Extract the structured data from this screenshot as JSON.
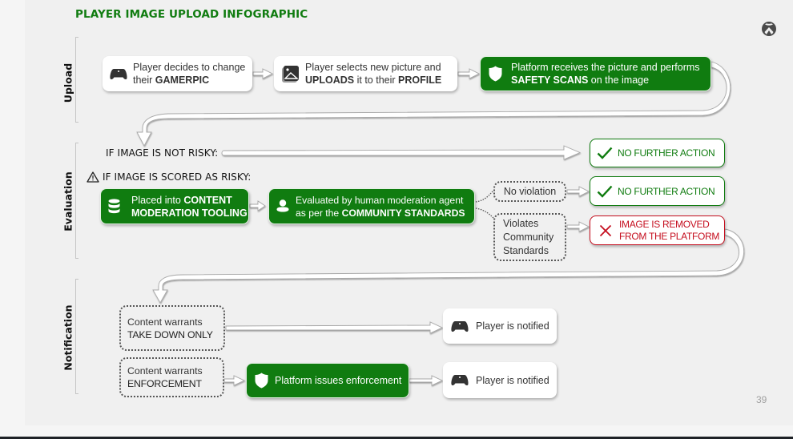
{
  "title": "PLAYER IMAGE UPLOAD INFOGRAPHIC",
  "brand_icon": "xbox-logo-icon",
  "page_number": "39",
  "colors": {
    "green": "#107c10",
    "red": "#c50f1f",
    "icon_gray": "#3b3b3b"
  },
  "sections": {
    "upload": "Upload",
    "evaluation": "Evaluation",
    "notification": "Notification"
  },
  "upload": {
    "steps": [
      {
        "icon": "gamepad-icon",
        "pre": "Player decides to change their ",
        "bold": "GAMERPIC",
        "post": ""
      },
      {
        "icon": "image-icon",
        "pre": "Player selects new picture and ",
        "bold": "UPLOADS",
        "mid": " it to their ",
        "bold2": "PROFILE"
      },
      {
        "icon": "shield-icon",
        "pre": "Platform receives the picture and performs ",
        "bold": "SAFETY SCANS",
        "post": " on the image"
      }
    ]
  },
  "evaluation": {
    "not_risky_label": "IF IMAGE IS NOT RISKY:",
    "not_risky_result": "NO FURTHER ACTION",
    "risky_label": "IF IMAGE IS SCORED AS RISKY:",
    "risky_icon": "warning-icon",
    "tooling": {
      "icon": "database-icon",
      "pre": "Placed into ",
      "bold": "CONTENT MODERATION TOOLING"
    },
    "human": {
      "icon": "person-icon",
      "pre": "Evaluated by human moderation agent as per the ",
      "bold": "COMMUNITY STANDARDS"
    },
    "no_violation": "No violation",
    "no_violation_result": "NO FURTHER ACTION",
    "violates": "Violates Community Standards",
    "violates_result": "IMAGE IS REMOVED FROM THE PLATFORM"
  },
  "notification": {
    "takedown": {
      "pre": "Content warrants",
      "bold": "TAKE DOWN ONLY"
    },
    "enforcement": {
      "pre": "Content warrants",
      "bold": "ENFORCEMENT"
    },
    "platform_enforcement": "Platform issues enforcement",
    "notified_1": "Player is notified",
    "notified_2": "Player is notified"
  }
}
